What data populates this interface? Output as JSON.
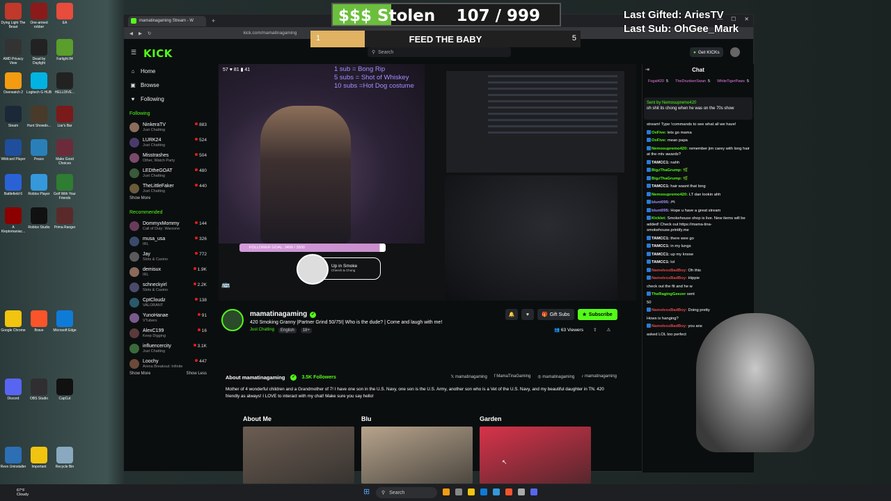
{
  "desktop_icons": [
    {
      "label": "Dying Light The Beast",
      "color": "#c0392b"
    },
    {
      "label": "One-armed robber",
      "color": "#8b1a1a"
    },
    {
      "label": "EA",
      "color": "#e74c3c"
    },
    {
      "label": "AMD Privacy View",
      "color": "#333"
    },
    {
      "label": "Dead by Daylight",
      "color": "#222"
    },
    {
      "label": "Farlight 84",
      "color": "#5a9e2b"
    },
    {
      "label": "Overwatch 2",
      "color": "#f39c12"
    },
    {
      "label": "Logitech G HUB",
      "color": "#00b3e3"
    },
    {
      "label": "HELLDIVE...",
      "color": "#222"
    },
    {
      "label": "Steam",
      "color": "#1b2838"
    },
    {
      "label": "Hunt Showdo...",
      "color": "#4a3a2a"
    },
    {
      "label": "Liar's Bar",
      "color": "#7a1a1a"
    },
    {
      "label": "Wildcard Player",
      "color": "#1f4f9c"
    },
    {
      "label": "Peace",
      "color": "#2980b9"
    },
    {
      "label": "Make Good Choices",
      "color": "#6b2b3a"
    },
    {
      "label": "Battlefield 6",
      "color": "#2a62d6"
    },
    {
      "label": "Roblox Player",
      "color": "#3498db"
    },
    {
      "label": "Golf With Your Friends",
      "color": "#2e7d32"
    },
    {
      "label": "A Kleptomaniac...",
      "color": "#8b0000"
    },
    {
      "label": "Roblox Studio",
      "color": "#111"
    },
    {
      "label": "Prima Ranger",
      "color": "#5a2a2a"
    },
    {
      "label": "Google Chrome",
      "color": "#f1c40f"
    },
    {
      "label": "Brave",
      "color": "#fb542b"
    },
    {
      "label": "Microsoft Edge",
      "color": "#0f7bd8"
    },
    {
      "label": "Discord",
      "color": "#5865f2"
    },
    {
      "label": "OBS Studio",
      "color": "#302e31"
    },
    {
      "label": "CapCut",
      "color": "#111"
    },
    {
      "label": "Revo Uninstaller",
      "color": "#2c6fb5"
    },
    {
      "label": "Important",
      "color": "#f1c40f"
    },
    {
      "label": "Recycle Bin",
      "color": "#8aa9c0"
    }
  ],
  "browser": {
    "tab_title": "mamatinagaming Stream - W",
    "new_tab": "+",
    "url": "kick.com/mamatinagaming",
    "window_controls": [
      "—",
      "☐",
      "✕"
    ]
  },
  "kick": {
    "logo": "KICK",
    "search_placeholder": "Search",
    "get_kicks": "Get KICKs",
    "nav": [
      {
        "icon": "home-icon",
        "glyph": "⌂",
        "label": "Home"
      },
      {
        "icon": "browse-icon",
        "glyph": "▣",
        "label": "Browse"
      },
      {
        "icon": "heart-icon",
        "glyph": "♥",
        "label": "Following"
      }
    ],
    "following_title": "Following",
    "following": [
      {
        "name": "NinkeraTV",
        "game": "Just Chatting",
        "viewers": "883",
        "color": "#8a6d5a"
      },
      {
        "name": "LURK24",
        "game": "Just Chatting",
        "viewers": "524",
        "color": "#4a3a6a"
      },
      {
        "name": "Misstrashes",
        "game": "Other, Watch Party",
        "viewers": "504",
        "color": "#7a4a6a"
      },
      {
        "name": "LEDtheGOAT",
        "game": "Just Chatting",
        "viewers": "480",
        "color": "#3a5a3a"
      },
      {
        "name": "TheLittleFaker",
        "game": "Just Chatting",
        "viewers": "440",
        "color": "#6a5a3a"
      }
    ],
    "show_more": "Show More",
    "recommended_title": "Recommended",
    "recommended": [
      {
        "name": "DommyxMommy",
        "game": "Call of Duty: Warzone",
        "viewers": "144",
        "color": "#6a3a5a"
      },
      {
        "name": "musa_usa",
        "game": "IRL",
        "viewers": "326",
        "color": "#3a4a6a"
      },
      {
        "name": "Jay",
        "game": "Slots & Casino",
        "viewers": "772",
        "color": "#5a5a5a"
      },
      {
        "name": "demisux",
        "game": "IRL",
        "viewers": "1.9K",
        "color": "#8a6a5a"
      },
      {
        "name": "schneckyirl",
        "game": "Slots & Casino",
        "viewers": "2.2K",
        "color": "#4a4a6a"
      },
      {
        "name": "CptCloudz",
        "game": "VALORANT",
        "viewers": "138",
        "color": "#2a5a6a"
      },
      {
        "name": "YunoHanae",
        "game": "VTubers",
        "viewers": "91",
        "color": "#7a5a8a"
      },
      {
        "name": "AlexC199",
        "game": "Keep Digging",
        "viewers": "16",
        "color": "#5a3a3a"
      },
      {
        "name": "influencercity",
        "game": "Just Chatting",
        "viewers": "3.1K",
        "color": "#3a6a3a"
      },
      {
        "name": "Loochy",
        "game": "Arena Breakout: Infinite",
        "viewers": "447",
        "color": "#6a4a3a"
      }
    ],
    "show_less": "Show Less"
  },
  "stream": {
    "overlay_stats": "57 ♥ 81 ▮ 41",
    "sub_menu": [
      "1 sub = Bong Rip",
      "5 subs = Shot of Whiskey",
      "10 subs =Hot Dog costume"
    ],
    "follower_goal": "FOLLOWER GOAL: 3499 / 3500",
    "follower_goal_fraction": 0.9997,
    "up_in_smoke": "Up in Smoke",
    "up_in_smoke_sub": "Cheech & Chong",
    "channel_name": "mamatinagaming",
    "title": "420 Smoking Granny |Partner Grind 50/75!| Who is the dude? | Come and laugh with me!",
    "category": "Just Chatting",
    "tags": [
      "English",
      "18+"
    ],
    "gift_subs": "Gift Subs",
    "subscribe": "Subscribe",
    "viewers": "63 Viewers"
  },
  "about": {
    "heading": "About mamatinagaming",
    "followers": "3.5K Followers",
    "socials": [
      "mamatinagaming",
      "MamaTinaGaming",
      "mamatinagaming",
      "mamatinagaming"
    ],
    "bio": "Mother of 4 wonderful children and a Grandmother of 7! I have one son in the U.S. Navy, one son is the U.S. Army, another son who is a Vet of the U.S. Navy, and my beautiful daughter in TN. 420 friendly as always! I LOVE to interact with my chat! Make sure you say hello!"
  },
  "panels": [
    {
      "title": "About Me",
      "color": "#6c5d52"
    },
    {
      "title": "Blu",
      "color": "#b7a48c"
    },
    {
      "title": "Garden",
      "color": "#d8334a"
    }
  ],
  "chat": {
    "title": "Chat",
    "gifters": [
      {
        "name": "Fogal420",
        "count": "5"
      },
      {
        "name": "TheDrunkenSwan",
        "count": "5"
      },
      {
        "name": "WhiteTigerPaws",
        "count": "5"
      }
    ],
    "pinned_by": "Sent by Nemosupremo420",
    "pinned_user": "Nemosupremo420",
    "pinned_text": "oh shit its chong when he was on the 70s show",
    "messages": [
      {
        "user": "",
        "text": "stream! Type !commands to see what all we have!",
        "color": "#ffffff"
      },
      {
        "user": "OxFive:",
        "text": "lets go mama",
        "color": "#53fc18"
      },
      {
        "user": "OxFive:",
        "text": "mean papa",
        "color": "#53fc18"
      },
      {
        "user": "Nemosupremo420:",
        "text": "remember jim carey with long hair at the mtv awards?",
        "color": "#53fc18"
      },
      {
        "user": "TAMCC1:",
        "text": "nahh",
        "color": "#ffffff"
      },
      {
        "user": "BigzThaGrump:",
        "text": "🌿",
        "color": "#53fc18"
      },
      {
        "user": "BigzThaGrump:",
        "text": "🌿",
        "color": "#53fc18"
      },
      {
        "user": "TAMCC1:",
        "text": "hair wasnt that long",
        "color": "#ffffff"
      },
      {
        "user": "Nemosupremo420:",
        "text": "LT dan lookin ahh",
        "color": "#53fc18"
      },
      {
        "user": "blunt095:",
        "text": "🎮",
        "color": "#a48fff"
      },
      {
        "user": "blunt095:",
        "text": "Hope u have a great stream",
        "color": "#a48fff"
      },
      {
        "user": "Kicklet:",
        "text": "Smokehouse shop is live. New items will be added! Check out https://mama-tina-smokehouse.printify.me",
        "color": "#53fc18"
      },
      {
        "user": "TAMCC1:",
        "text": "there wee go",
        "color": "#ffffff"
      },
      {
        "user": "TAMCC1:",
        "text": "in my lungs",
        "color": "#ffffff"
      },
      {
        "user": "TAMCC1:",
        "text": "up my knose",
        "color": "#ffffff"
      },
      {
        "user": "TAMCC1:",
        "text": "lol",
        "color": "#ffffff"
      },
      {
        "user": "NamelessBadBoy:",
        "text": "Oh this",
        "color": "#e0494b"
      },
      {
        "user": "NamelessBadBoy:",
        "text": "Hippie",
        "color": "#e0494b"
      },
      {
        "user": "",
        "text": "check out the fit and he w",
        "color": "#ffffff"
      },
      {
        "user": "TheRagingGeezer",
        "text": "sent",
        "color": "#53fc18"
      },
      {
        "user": "",
        "text": "50",
        "color": "#53fc18"
      },
      {
        "user": "NamelessBadBoy:",
        "text": "Doing pretty",
        "color": "#e0494b"
      },
      {
        "user": "",
        "text": "Hows is hanging?",
        "color": "#ffffff"
      },
      {
        "user": "NamelessBadBoy:",
        "text": "you ans",
        "color": "#e0494b"
      },
      {
        "user": "",
        "text": "asked LOL too perfect",
        "color": "#ffffff"
      }
    ]
  },
  "hud": {
    "stolen_label": "$$$ Stolen",
    "stolen_count": "107 / 999",
    "feed_left": "1",
    "feed_text": "FEED THE BABY",
    "feed_right": "5",
    "feed_fraction": 0.2,
    "last_gifted": "Last Gifted: AriesTV",
    "last_sub": "Last Sub: OhGee_Mark"
  },
  "taskbar": {
    "weather_temp": "67°F",
    "weather_desc": "Cloudy",
    "search": "Search"
  }
}
